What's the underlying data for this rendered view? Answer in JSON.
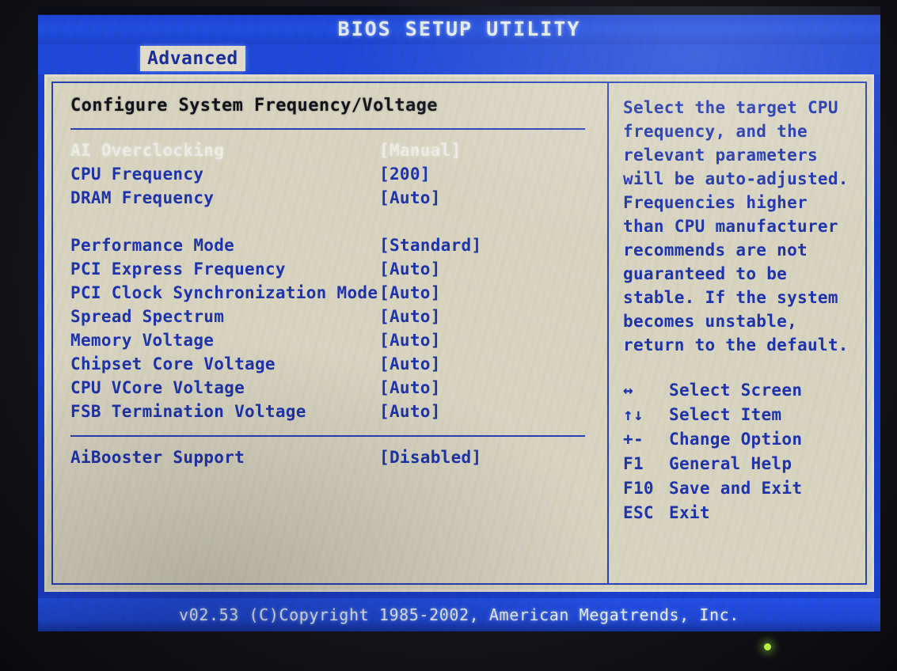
{
  "titlebar": {
    "title": "BIOS SETUP UTILITY"
  },
  "tabs": [
    {
      "label": "Advanced",
      "active": true
    }
  ],
  "main": {
    "section_heading": "Configure System Frequency/Voltage",
    "groups": [
      {
        "options": [
          {
            "label": "AI Overclocking",
            "value": "[Manual]",
            "selected": true
          },
          {
            "label": "CPU Frequency",
            "value": "[200]",
            "selected": false
          },
          {
            "label": "DRAM Frequency",
            "value": "[Auto]",
            "selected": false
          }
        ]
      },
      {
        "options": [
          {
            "label": "Performance Mode",
            "value": "[Standard]",
            "selected": false
          },
          {
            "label": "PCI Express Frequency",
            "value": "[Auto]",
            "selected": false
          },
          {
            "label": "PCI Clock Synchronization Mode",
            "value": "[Auto]",
            "selected": false
          },
          {
            "label": "Spread Spectrum",
            "value": "[Auto]",
            "selected": false
          },
          {
            "label": "Memory Voltage",
            "value": "[Auto]",
            "selected": false
          },
          {
            "label": "Chipset Core Voltage",
            "value": "[Auto]",
            "selected": false
          },
          {
            "label": "CPU VCore Voltage",
            "value": "[Auto]",
            "selected": false
          },
          {
            "label": "FSB Termination Voltage",
            "value": "[Auto]",
            "selected": false
          }
        ]
      },
      {
        "options": [
          {
            "label": "AiBooster Support",
            "value": "[Disabled]",
            "selected": false
          }
        ]
      }
    ]
  },
  "help": {
    "lines": [
      "Select the target CPU",
      "frequency, and the",
      "relevant parameters",
      "will be auto-adjusted.",
      "Frequencies higher",
      "than CPU manufacturer",
      "recommends are not",
      "guaranteed to be",
      "stable. If the system",
      "becomes unstable,",
      "return to the default."
    ],
    "keys": [
      {
        "glyph": "↔",
        "name": "left-right-arrow-icon",
        "desc": "Select Screen"
      },
      {
        "glyph": "↑↓",
        "name": "up-down-arrow-icon",
        "desc": "Select Item"
      },
      {
        "glyph": "+-",
        "name": "plus-minus-icon",
        "desc": "Change Option"
      },
      {
        "glyph": "F1",
        "name": "f1-key",
        "desc": "General Help"
      },
      {
        "glyph": "F10",
        "name": "f10-key",
        "desc": "Save and Exit"
      },
      {
        "glyph": "ESC",
        "name": "esc-key",
        "desc": "Exit"
      }
    ]
  },
  "footer": {
    "copyright": "v02.53 (C)Copyright 1985-2002, American Megatrends, Inc."
  },
  "colors": {
    "screen_blue": "#1f49dd",
    "panel_beige": "#ded8c4",
    "text_blue": "#1f34ae",
    "selected_text": "#f3f1ea",
    "heading_black": "#11131c",
    "led_green": "#b9ef42"
  }
}
